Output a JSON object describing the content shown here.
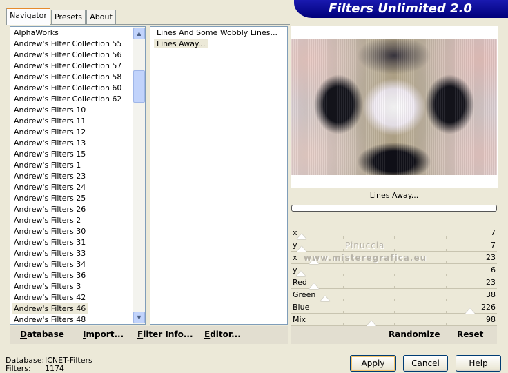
{
  "tabs": [
    {
      "label": "Navigator",
      "active": true
    },
    {
      "label": "Presets",
      "active": false
    },
    {
      "label": "About",
      "active": false
    }
  ],
  "banner_title": "Filters Unlimited 2.0",
  "categories": [
    "AlphaWorks",
    "Andrew's Filter Collection 55",
    "Andrew's Filter Collection 56",
    "Andrew's Filter Collection 57",
    "Andrew's Filter Collection 58",
    "Andrew's Filter Collection 60",
    "Andrew's Filter Collection 62",
    "Andrew's Filters 10",
    "Andrew's Filters 11",
    "Andrew's Filters 12",
    "Andrew's Filters 13",
    "Andrew's Filters 15",
    "Andrew's Filters 1",
    "Andrew's Filters 23",
    "Andrew's Filters 24",
    "Andrew's Filters 25",
    "Andrew's Filters 26",
    "Andrew's Filters 2",
    "Andrew's Filters 30",
    "Andrew's Filters 31",
    "Andrew's Filters 33",
    "Andrew's Filters 34",
    "Andrew's Filters 36",
    "Andrew's Filters 3",
    "Andrew's Filters 42",
    "Andrew's Filters 46",
    "Andrew's Filters 48"
  ],
  "selected_category": "Andrew's Filters 46",
  "filters": [
    "Lines And Some Wobbly Lines...",
    "Lines Away..."
  ],
  "selected_filter": "Lines Away...",
  "current_filter_name": "Lines Away...",
  "watermark": {
    "line1": "Pinuccia",
    "line2": "www.misteregrafica.eu"
  },
  "params": [
    {
      "label": "x",
      "value": 7
    },
    {
      "label": "y",
      "value": 7
    },
    {
      "label": "x",
      "value": 23
    },
    {
      "label": "y",
      "value": 6
    },
    {
      "label": "Red",
      "value": 23
    },
    {
      "label": "Green",
      "value": 38
    },
    {
      "label": "Blue",
      "value": 226
    },
    {
      "label": "Mix",
      "value": 98
    }
  ],
  "param_max": 255,
  "left_buttons": {
    "database": {
      "ul": "D",
      "rest": "atabase"
    },
    "import": {
      "ul": "I",
      "rest": "mport..."
    },
    "filter_info": {
      "ul": "F",
      "rest": "ilter Info..."
    },
    "editor": {
      "ul": "E",
      "rest": "ditor..."
    }
  },
  "right_buttons": {
    "randomize": "Randomize",
    "reset": "Reset"
  },
  "status": {
    "database_label": "Database:",
    "database_value": "ICNET-Filters",
    "filters_label": "Filters:",
    "filters_value": "1174"
  },
  "dialog_buttons": {
    "apply": "Apply",
    "cancel": "Cancel",
    "help": "Help"
  },
  "colors": {
    "banner": "#0a0a9a",
    "accent_tab": "#e68b2c"
  }
}
